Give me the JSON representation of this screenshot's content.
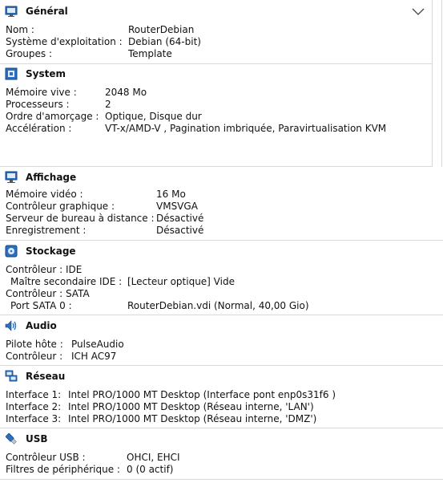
{
  "general": {
    "title": "Général",
    "rows": [
      {
        "key": "Nom :",
        "value": "RouterDebian"
      },
      {
        "key": "Système d'exploitation :",
        "value": "Debian (64-bit)"
      },
      {
        "key": "Groupes :",
        "value": "Template"
      }
    ]
  },
  "system": {
    "title": "System",
    "rows": [
      {
        "key": "Mémoire vive :",
        "value": "2048 Mo"
      },
      {
        "key": "Processeurs :",
        "value": "2"
      },
      {
        "key": "Ordre d'amorçage :",
        "value": "Optique, Disque dur"
      },
      {
        "key": "Accélération :",
        "value": "VT-x/AMD-V , Pagination imbriquée, Paravirtualisation KVM"
      }
    ]
  },
  "display": {
    "title": "Affichage",
    "rows": [
      {
        "key": "Mémoire vidéo :",
        "value": "16 Mo"
      },
      {
        "key": "Contrôleur graphique :",
        "value": "VMSVGA"
      },
      {
        "key": "Serveur de bureau à distance :",
        "value": "Désactivé"
      },
      {
        "key": "Enregistrement :",
        "value": "Désactivé"
      }
    ]
  },
  "storage": {
    "title": "Stockage",
    "rows": [
      {
        "key": "Contrôleur : IDE",
        "value": ""
      },
      {
        "key": "Maître secondaire IDE :",
        "value": "[Lecteur optique] Vide"
      },
      {
        "key": "Contrôleur : SATA",
        "value": ""
      },
      {
        "key": "Port SATA 0 :",
        "value": "RouterDebian.vdi (Normal, 40,00 Gio)"
      }
    ]
  },
  "audio": {
    "title": "Audio",
    "rows": [
      {
        "key": "Pilote hôte :",
        "value": "PulseAudio"
      },
      {
        "key": "Contrôleur :",
        "value": "ICH AC97"
      }
    ]
  },
  "network": {
    "title": "Réseau",
    "rows": [
      {
        "key": "Interface 1:",
        "value": "Intel PRO/1000 MT Desktop (Interface pont enp0s31f6 )"
      },
      {
        "key": "Interface 2:",
        "value": "Intel PRO/1000 MT Desktop (Réseau interne, 'LAN')"
      },
      {
        "key": "Interface 3:",
        "value": "Intel PRO/1000 MT Desktop (Réseau interne, 'DMZ')"
      }
    ]
  },
  "usb": {
    "title": "USB",
    "rows": [
      {
        "key": "Contrôleur USB :",
        "value": "OHCI, EHCI"
      },
      {
        "key": "Filtres de périphérique :",
        "value": "0 (0 actif)"
      }
    ]
  },
  "icons": {
    "general": "monitor-icon",
    "system": "chip-icon",
    "display": "display-icon",
    "storage": "disk-icon",
    "audio": "speaker-icon",
    "network": "network-icon",
    "usb": "usb-icon",
    "collapse": "chevron-down-icon"
  },
  "colors": {
    "icon_blue": "#2a6fc0",
    "divider": "#d9d9d9"
  }
}
